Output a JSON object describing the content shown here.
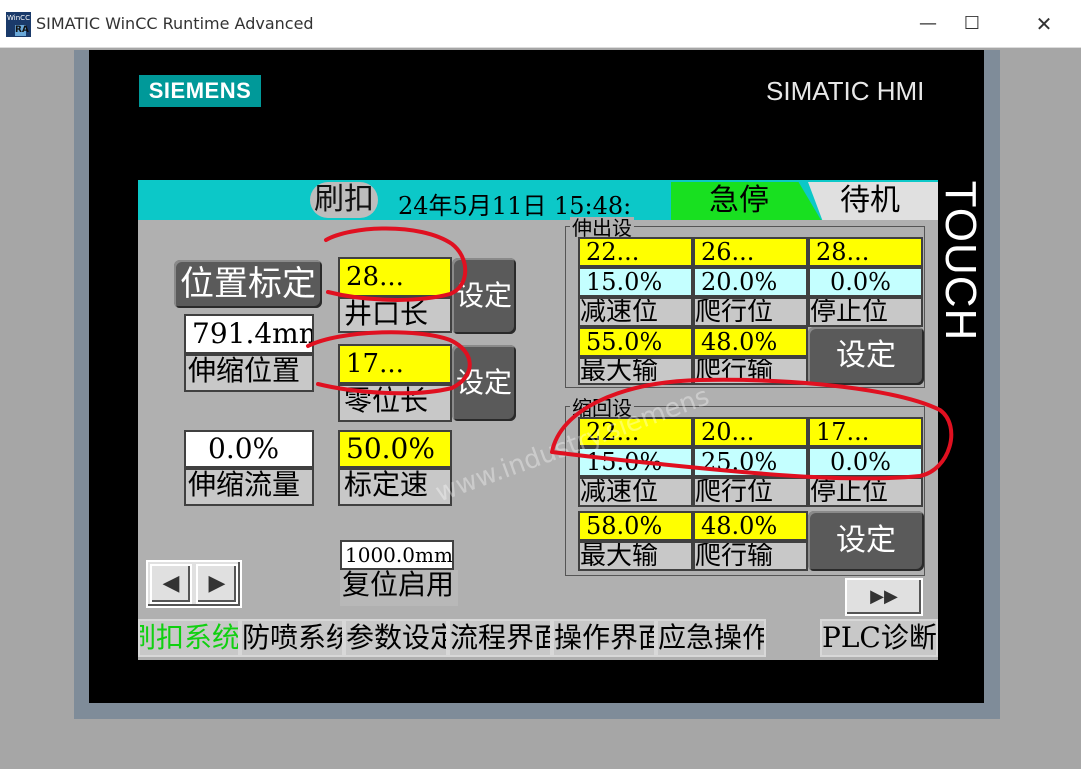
{
  "window": {
    "app_icon_text": "WinCC",
    "app_icon_sub": "RA",
    "title": "SIMATIC WinCC Runtime Advanced",
    "min": "—",
    "max": "☐",
    "close": "✕"
  },
  "device": {
    "brand": "SIEMENS",
    "model": "SIMATIC HMI",
    "touch": "TOUCH"
  },
  "header": {
    "title": "刷扣",
    "datetime": "24年5月11日  15:48:",
    "estop": "急停",
    "status": "待机"
  },
  "left": {
    "position_calib_button": "位置标定",
    "well_length_value": "28...",
    "well_length_label": "井口长",
    "set_button_1": "设定",
    "zero_length_value": "17...",
    "zero_length_label": "零位长",
    "set_button_2": "设定",
    "extend_position_value": "791.4mm",
    "extend_position_label": "伸缩位置",
    "extend_flow_value": "0.0%",
    "extend_flow_label": "伸缩流量",
    "calib_speed_value": "50.0%",
    "calib_speed_label": "标定速",
    "reset_value": "1000.0mm",
    "reset_label": "复位启用"
  },
  "extend_group": {
    "title": "伸出设",
    "row1": [
      "22...",
      "26...",
      "28..."
    ],
    "row2": [
      "15.0%",
      "20.0%",
      "0.0%"
    ],
    "row3": [
      "减速位",
      "爬行位",
      "停止位"
    ],
    "row4": [
      "55.0%",
      "48.0%"
    ],
    "row5": [
      "最大输",
      "爬行输"
    ],
    "set_button": "设定"
  },
  "retract_group": {
    "title": "缩回设",
    "row1": [
      "22...",
      "20...",
      "17..."
    ],
    "row2": [
      "15.0%",
      "25.0%",
      "0.0%"
    ],
    "row3": [
      "减速位",
      "爬行位",
      "停止位"
    ],
    "row4": [
      "58.0%",
      "48.0%"
    ],
    "row5": [
      "最大输",
      "爬行输"
    ],
    "set_button": "设定"
  },
  "nav": {
    "prev": "◀",
    "next": "▶",
    "forward": "▶▶",
    "items": [
      "刷扣系统",
      "防喷系统",
      "参数设定",
      "流程界面",
      "操作界面",
      "应急操作",
      "PLC诊断"
    ]
  },
  "watermark": "www.industry.siemens",
  "colors": {
    "header": "#0cc8c8",
    "estop": "#18e020",
    "value_yellow": "#ffff00",
    "value_cyan": "#c4ffff",
    "siemens_teal": "#009999",
    "annotation_red": "#e01020"
  }
}
